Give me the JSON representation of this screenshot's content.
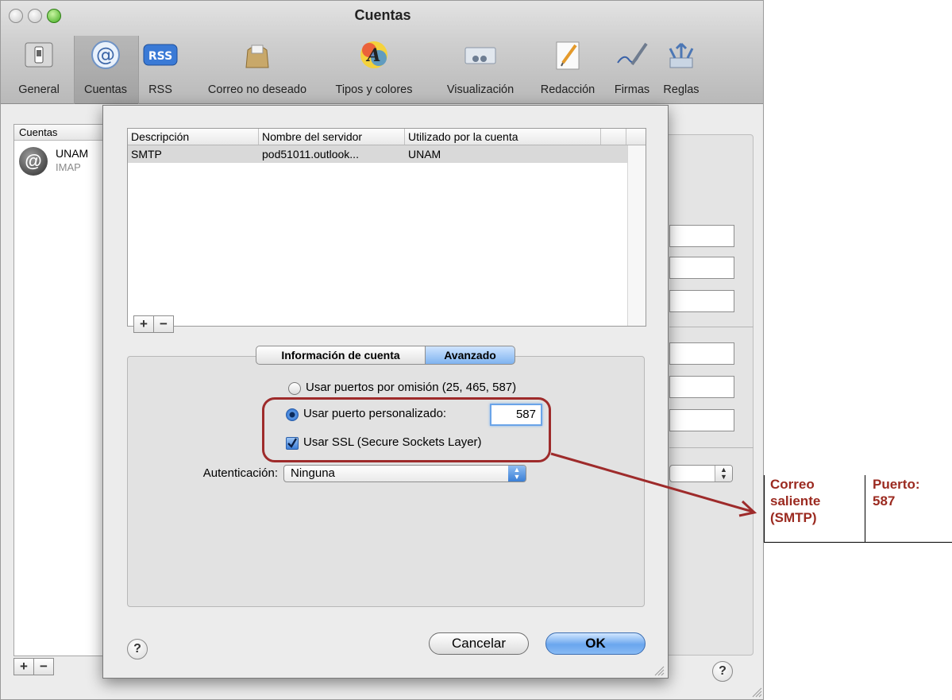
{
  "window": {
    "title": "Cuentas"
  },
  "toolbar": {
    "items": [
      {
        "label": "General",
        "icon": "general-switch-icon"
      },
      {
        "label": "Cuentas",
        "icon": "at-sign-icon"
      },
      {
        "label": "RSS",
        "icon": "rss-icon"
      },
      {
        "label": "Correo no deseado",
        "icon": "junk-mail-bag-icon"
      },
      {
        "label": "Tipos y colores",
        "icon": "fonts-colors-icon"
      },
      {
        "label": "Visualización",
        "icon": "viewing-icon"
      },
      {
        "label": "Redacción",
        "icon": "composing-pencil-icon"
      },
      {
        "label": "Firmas",
        "icon": "signature-pen-icon"
      },
      {
        "label": "Reglas",
        "icon": "rules-arrows-icon"
      }
    ],
    "selected": "Cuentas"
  },
  "sidebar": {
    "header": "Cuentas",
    "accounts": [
      {
        "name": "UNAM",
        "type": "IMAP",
        "icon": "at-sign-icon"
      }
    ],
    "add_label": "+",
    "remove_label": "−"
  },
  "sheet": {
    "table": {
      "columns": [
        "Descripción",
        "Nombre del servidor",
        "Utilizado por la cuenta"
      ],
      "rows": [
        {
          "description": "SMTP",
          "server": "pod51011.outlook...",
          "used_by": "UNAM"
        }
      ]
    },
    "add_label": "+",
    "remove_label": "−",
    "tabs": {
      "info": "Información de cuenta",
      "advanced": "Avanzado",
      "selected": "Avanzado"
    },
    "options": {
      "default_ports": {
        "label": "Usar puertos por omisión (25, 465, 587)",
        "selected": false
      },
      "custom_port": {
        "label": "Usar puerto personalizado:",
        "selected": true,
        "value": "587"
      },
      "ssl": {
        "label": "Usar SSL (Secure Sockets Layer)",
        "checked": true
      }
    },
    "auth": {
      "label": "Autenticación:",
      "value": "Ninguna"
    },
    "help_label": "?",
    "cancel_label": "Cancelar",
    "ok_label": "OK"
  },
  "background_help_label": "?",
  "annotation": {
    "left_text": [
      "Correo",
      "saliente",
      "(SMTP)"
    ],
    "right_text": [
      "Puerto:",
      "587"
    ],
    "color": "#9b2a20"
  },
  "colors": {
    "selection_blue": "#7fb3ef",
    "window_bg": "#ececec",
    "annotation_red": "#9e2b2b"
  }
}
